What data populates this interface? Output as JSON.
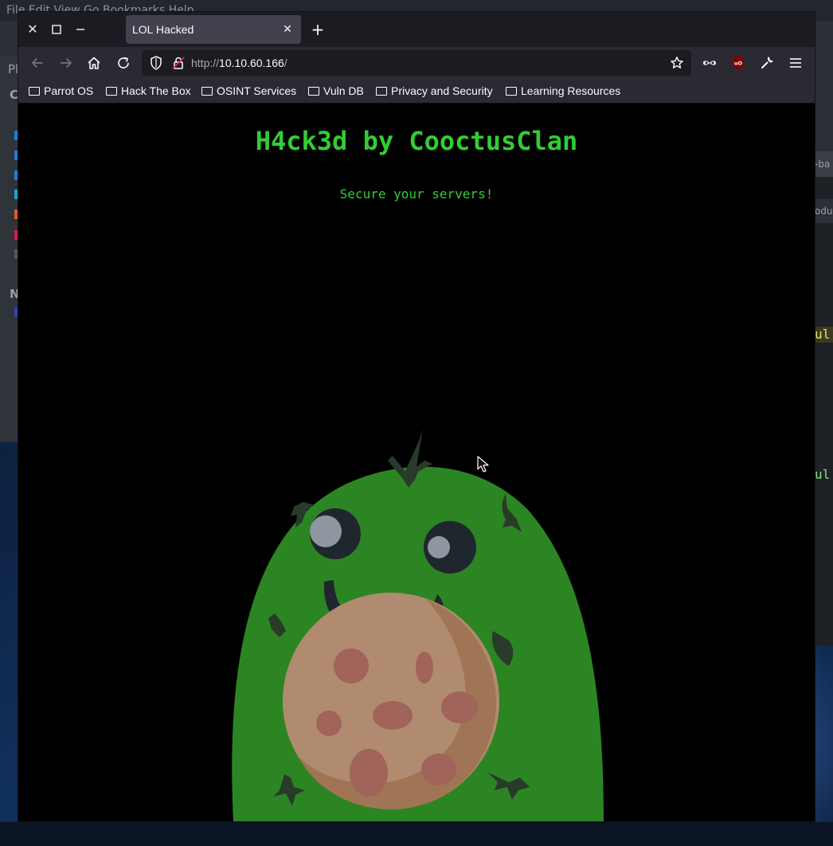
{
  "background_window": {
    "menubar": "File  Edit  View  Go  Bookmarks  Help",
    "side_label": "Pl",
    "right_tab": "-ba",
    "right_tab2": "odu",
    "code_line_1": "ul",
    "code_line_2": "ul"
  },
  "window_controls": {
    "close": "✕",
    "maximize": "☐",
    "minimize": "—"
  },
  "tab": {
    "title": "LOL Hacked",
    "close": "✕"
  },
  "new_tab": "+",
  "url": {
    "protocol": "http://",
    "host": "10.10.60.166",
    "path": "/"
  },
  "bookmarks": [
    "Parrot OS",
    "Hack The Box",
    "OSINT Services",
    "Vuln DB",
    "Privacy and Security",
    "Learning Resources"
  ],
  "page": {
    "title": "H4ck3d by CooctusClan",
    "subtitle": "Secure your servers!"
  },
  "colors": {
    "hack_green": "#33cc33",
    "mascot_green": "#2c8523",
    "cookie": "#b18b6f",
    "cookie_shadow": "#a07555",
    "chip": "#a0645a"
  }
}
